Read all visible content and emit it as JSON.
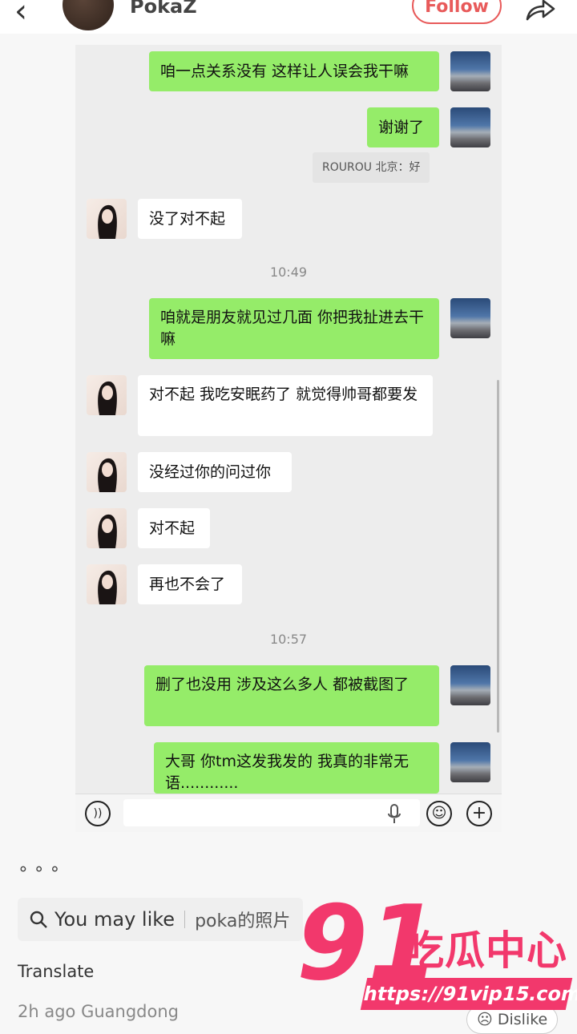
{
  "header": {
    "username": "PokaZ",
    "follow_label": "Follow"
  },
  "chat": {
    "messages": [
      {
        "side": "me",
        "text": "咱一点关系没有 这样让人误会我干嘛"
      },
      {
        "side": "me",
        "text": "谢谢了"
      },
      {
        "side": "quote",
        "text": "ROUROU 北京：好"
      },
      {
        "side": "her",
        "text": "没了对不起"
      },
      {
        "side": "time",
        "text": "10:49"
      },
      {
        "side": "me",
        "text": "咱就是朋友就见过几面 你把我扯进去干嘛"
      },
      {
        "side": "her",
        "text": "对不起 我吃安眠药了 就觉得帅哥都要发"
      },
      {
        "side": "her",
        "text": "没经过你的问过你"
      },
      {
        "side": "her",
        "text": "对不起"
      },
      {
        "side": "her",
        "text": "再也不会了"
      },
      {
        "side": "time",
        "text": "10:57"
      },
      {
        "side": "me",
        "text": "删了也没用 涉及这么多人 都被截图了"
      },
      {
        "side": "me",
        "text": "大哥 你tm这发我发的 我真的非常无语............"
      }
    ]
  },
  "post": {
    "search_label": "You may like",
    "search_query": "poka的照片",
    "translate_label": "Translate",
    "meta": "2h ago Guangdong",
    "dislike_label": "Dislike"
  },
  "watermark": {
    "number": "91",
    "chinese": "吃瓜中心",
    "url": "https://91vip15.com"
  },
  "colors": {
    "accent": "#e85a5a",
    "bubble_green": "#95ec69",
    "watermark": "#f2386c"
  }
}
